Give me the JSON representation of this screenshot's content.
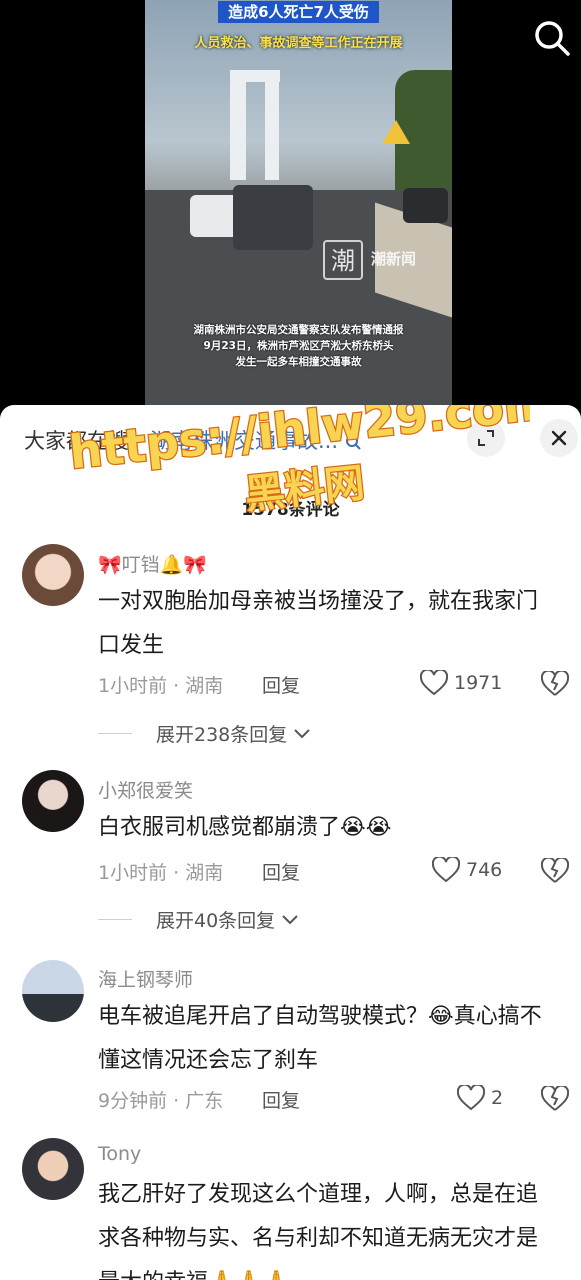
{
  "video": {
    "headline_top": "造成6人死亡7人受伤",
    "headline_sub": "人员救治、事故调查等工作正在开展",
    "logo_char": "潮",
    "logo_text": "潮新闻",
    "caption_lines": [
      "湖南株洲市公安局交通警察支队发布警情通报",
      "9月23日，株洲市芦淞区芦淞大桥东桥头",
      "发生一起多车相撞交通事故"
    ],
    "search_icon": "search-icon"
  },
  "sheet": {
    "search_prefix": "大家都在搜：",
    "search_query": "湖南株洲交通事故",
    "search_suffix": "...",
    "comment_count": "1578条评论",
    "watermark_url": "https://ihlw29.com",
    "watermark_name": "黑料网"
  },
  "comments": [
    {
      "username": "🎀叮铛🔔🎀",
      "text": "一对双胞胎加母亲被当场撞没了，就在我家门口发生",
      "time": "1小时前 · 湖南",
      "reply": "回复",
      "likes": "1971",
      "expand": "展开238条回复"
    },
    {
      "username": "小郑很爱笑",
      "text": "白衣服司机感觉都崩溃了😭😭",
      "time": "1小时前 · 湖南",
      "reply": "回复",
      "likes": "746",
      "expand": "展开40条回复"
    },
    {
      "username": "海上钢琴师",
      "text": "电车被追尾开启了自动驾驶模式？😂真心搞不懂这情况还会忘了刹车",
      "time": "9分钟前 · 广东",
      "reply": "回复",
      "likes": "2"
    },
    {
      "username": "Tony",
      "text": "我乙肝好了发现这么个道理，人啊，总是在追求各种物与实、名与利却不知道无病无灾才是最大的幸福🙏🙏🙏"
    }
  ],
  "colors": {
    "link": "#3d6db5",
    "headline_bg": "#1e56c8",
    "headline_sub": "#f6e14a"
  }
}
